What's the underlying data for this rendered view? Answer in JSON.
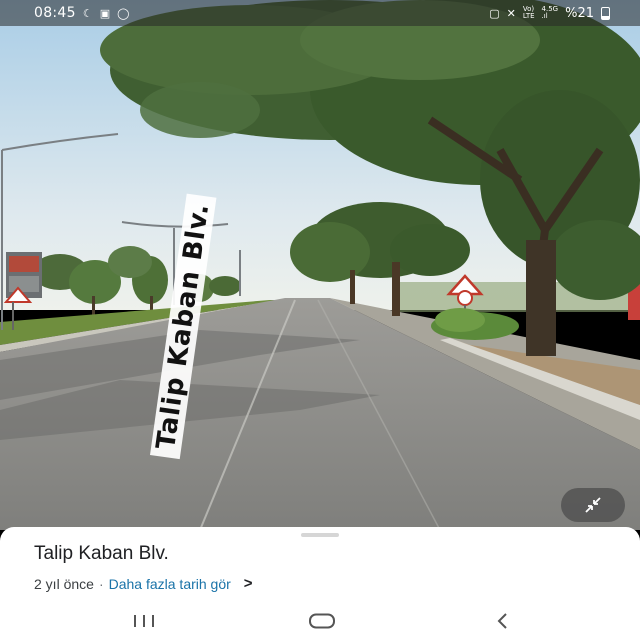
{
  "status_bar": {
    "time": "08:45",
    "left_icons": [
      "moon-icon",
      "gallery-icon",
      "whatsapp-icon"
    ],
    "right_icons": [
      "alarm-icon",
      "mute-icon"
    ],
    "network_label_top": "Vo)",
    "network_label_top2": "4.5G",
    "network_label_bottom": "LTE",
    "battery_percent": "%21"
  },
  "street_view": {
    "road_label": "Talip Kaban Blv."
  },
  "place_card": {
    "title": "Talip Kaban Blv.",
    "date": "2 yıl önce",
    "separator": "·",
    "history_link": "Daha fazla tarih gör",
    "chevron": ">"
  },
  "colors": {
    "link": "#1a73a8",
    "sky": "#b9d6e8",
    "road": "#8e8e8c",
    "foliage": "#3f5e32"
  },
  "nav_bar": {
    "icons": [
      "recent-apps-icon",
      "home-icon",
      "back-icon"
    ]
  }
}
